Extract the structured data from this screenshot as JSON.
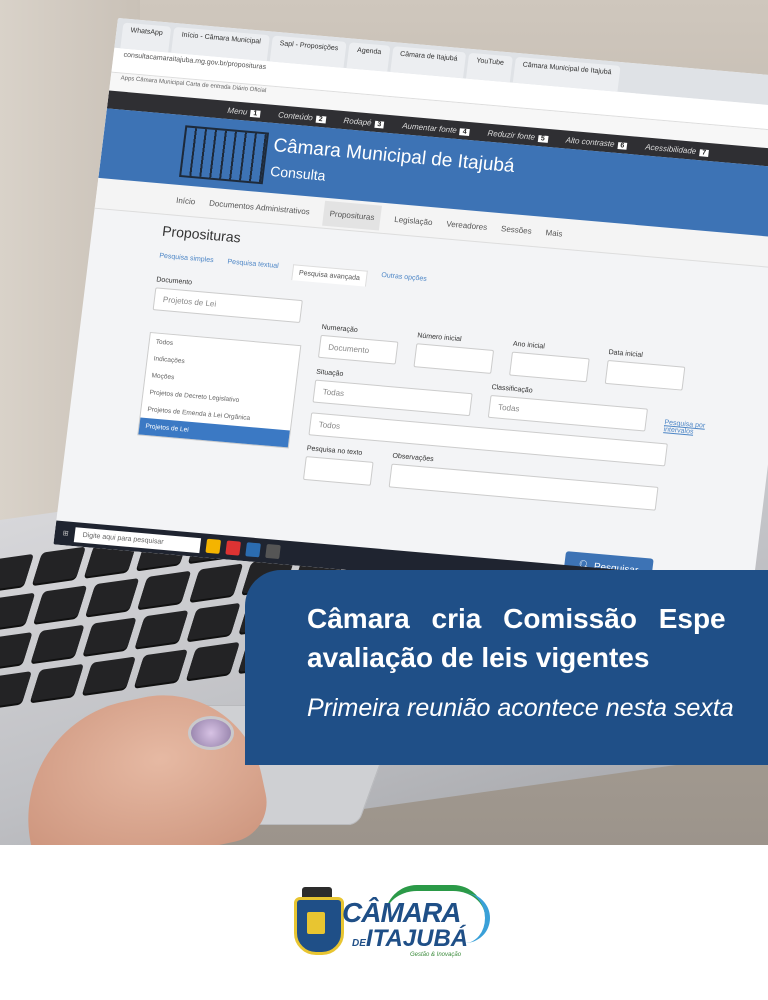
{
  "browser": {
    "tabs": [
      "WhatsApp",
      "Início - Câmara Municipal",
      "Sapl - Proposições",
      "Agenda",
      "Câmara de Itajubá",
      "YouTube",
      "Câmara Municipal de Itajubá"
    ],
    "address": "consultacamaraitajuba.mg.gov.br/proposituras",
    "bookmarks": "Apps   Câmara Municipal   Carta de entrada   Diário Oficial"
  },
  "accessibility": {
    "items": [
      {
        "label": "Menu",
        "key": "1"
      },
      {
        "label": "Conteúdo",
        "key": "2"
      },
      {
        "label": "Rodapé",
        "key": "3"
      },
      {
        "label": "Aumentar fonte",
        "key": "4"
      },
      {
        "label": "Reduzir fonte",
        "key": "5"
      },
      {
        "label": "Alto contraste",
        "key": "6"
      },
      {
        "label": "Acessibilidade",
        "key": "7"
      }
    ]
  },
  "site": {
    "title": "Câmara Municipal de Itajubá",
    "subtitle": "Consulta",
    "emblem_caption": "CÂMARA MUNICIPAL DE ITAJUBÁ"
  },
  "nav": {
    "items": [
      "Início",
      "Documentos Administrativos",
      "Proposituras",
      "Legislação",
      "Vereadores",
      "Sessões",
      "Mais"
    ]
  },
  "page": {
    "heading": "Proposituras",
    "subtabs": [
      "Pesquisa simples",
      "Pesquisa textual",
      "Pesquisa avançada",
      "Outras opções"
    ],
    "document_label": "Documento",
    "document_value": "Projetos de Lei",
    "dropdown_options": [
      "Todos",
      "Indicações",
      "Moções",
      "Projetos de Decreto Legislativo",
      "Projetos de Emenda à Lei Orgânica",
      "Projetos de Lei"
    ],
    "numeracao_label": "Numeração",
    "numeracao_value": "Documento",
    "numero_inicial_label": "Número inicial",
    "ano_inicial_label": "Ano inicial",
    "data_inicial_label": "Data inicial",
    "situacao_label": "Situação",
    "situacao_value": "Todas",
    "classificacao_label": "Classificação",
    "classificacao_value": "Todas",
    "pesquisa_intervalos": "Pesquisa por intervalos",
    "todos_value": "Todos",
    "pesquisa_texto_label": "Pesquisa no texto",
    "observacoes_label": "Observações",
    "search_button": "Pesquisar"
  },
  "taskbar": {
    "search_placeholder": "Digite aqui para pesquisar"
  },
  "headline": {
    "line1": "Câmara cria Comissão Espe",
    "line2": "avaliação de leis vigentes",
    "line3": "Primeira reunião acontece nesta sexta"
  },
  "logo": {
    "word1": "CÂMARA",
    "word2_small": "DE",
    "word2": "ITAJUBÁ",
    "tagline": "Gestão & Inovação"
  }
}
